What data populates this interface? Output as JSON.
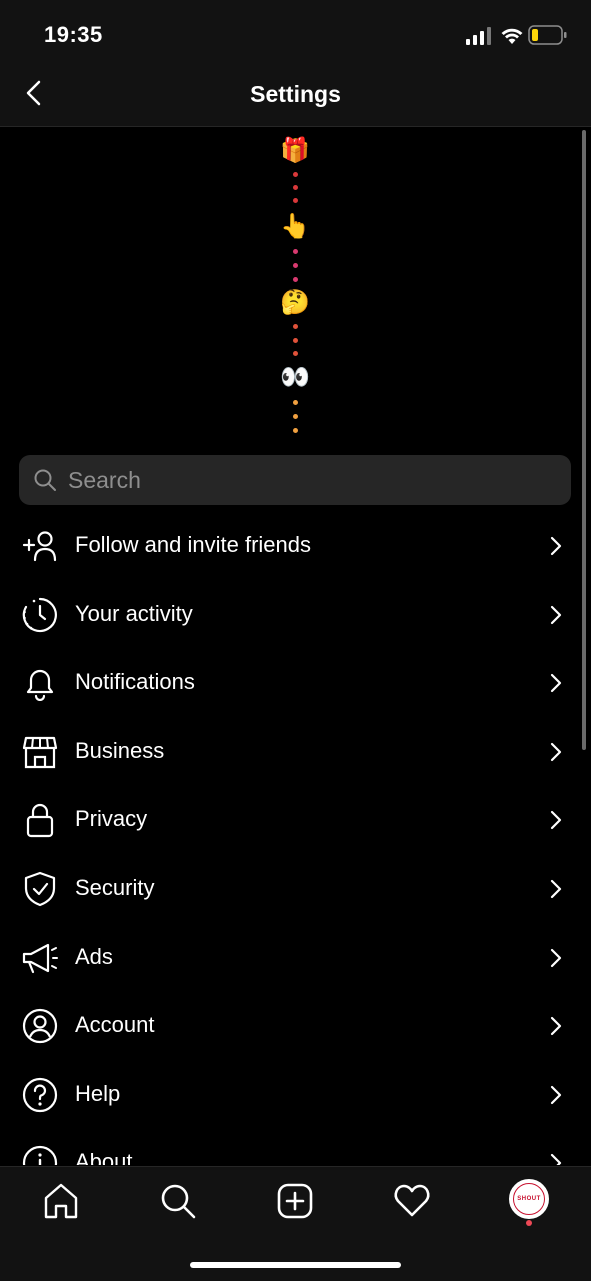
{
  "status_bar": {
    "time": "19:35"
  },
  "header": {
    "title": "Settings"
  },
  "emoji_trail": {
    "emojis": [
      "🎁",
      "👆",
      "🤔",
      "👀"
    ]
  },
  "search": {
    "placeholder": "Search"
  },
  "menu": {
    "items": [
      {
        "label": "Follow and invite friends",
        "icon": "add-person-icon"
      },
      {
        "label": "Your activity",
        "icon": "activity-clock-icon"
      },
      {
        "label": "Notifications",
        "icon": "bell-icon"
      },
      {
        "label": "Business",
        "icon": "shop-icon"
      },
      {
        "label": "Privacy",
        "icon": "lock-icon"
      },
      {
        "label": "Security",
        "icon": "shield-icon"
      },
      {
        "label": "Ads",
        "icon": "megaphone-icon"
      },
      {
        "label": "Account",
        "icon": "account-circle-icon"
      },
      {
        "label": "Help",
        "icon": "help-circle-icon"
      },
      {
        "label": "About",
        "icon": "info-circle-icon"
      }
    ]
  },
  "tab_bar": {
    "tabs": [
      "home-icon",
      "search-icon",
      "new-post-icon",
      "heart-icon",
      "profile-avatar"
    ],
    "avatar_text": "SHOUT"
  },
  "colors": {
    "background": "#000000",
    "bar": "#121212",
    "search_bg": "#262626",
    "notification_dot": "#ed4956"
  }
}
